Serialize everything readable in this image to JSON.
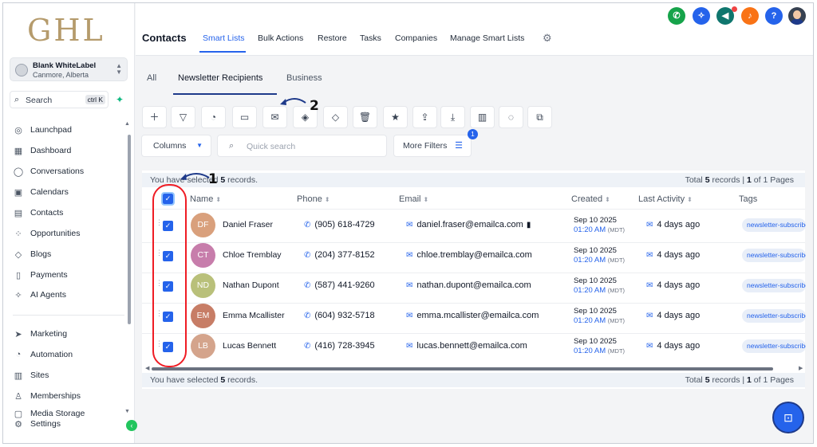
{
  "sidebar": {
    "logo": "GHL",
    "account_name": "Blank WhiteLabel",
    "account_location": "Canmore, Alberta",
    "search_label": "Search",
    "search_shortcut": "ctrl K",
    "items": [
      {
        "label": "Launchpad",
        "icon": "rocket-icon"
      },
      {
        "label": "Dashboard",
        "icon": "grid-icon"
      },
      {
        "label": "Conversations",
        "icon": "chat-bubble-icon"
      },
      {
        "label": "Calendars",
        "icon": "calendar-icon"
      },
      {
        "label": "Contacts",
        "icon": "contacts-icon"
      },
      {
        "label": "Opportunities",
        "icon": "opportunities-icon"
      },
      {
        "label": "Blogs",
        "icon": "cube-icon"
      },
      {
        "label": "Payments",
        "icon": "receipt-icon"
      },
      {
        "label": "AI Agents",
        "icon": "sparkle-icon"
      },
      {
        "label": "Marketing",
        "icon": "send-icon"
      },
      {
        "label": "Automation",
        "icon": "automation-icon"
      },
      {
        "label": "Sites",
        "icon": "sites-icon"
      },
      {
        "label": "Memberships",
        "icon": "membership-icon"
      },
      {
        "label": "Media Storage",
        "icon": "media-icon"
      },
      {
        "label": "Settings",
        "icon": "gear-icon"
      }
    ]
  },
  "topbar": {
    "title": "Contacts",
    "nav": [
      "Smart Lists",
      "Bulk Actions",
      "Restore",
      "Tasks",
      "Companies",
      "Manage Smart Lists"
    ],
    "icons": [
      {
        "name": "phone-icon",
        "color": "#16a34a"
      },
      {
        "name": "magic-icon",
        "color": "#2563eb"
      },
      {
        "name": "megaphone-icon",
        "color": "#0f766e"
      },
      {
        "name": "bell-icon",
        "color": "#f97316"
      },
      {
        "name": "help-icon",
        "color": "#2563eb"
      }
    ]
  },
  "tabs": [
    "All",
    "Newsletter Recipients",
    "Business"
  ],
  "toolbar_icons": [
    "plus-icon",
    "filter-icon",
    "automation-icon",
    "message-icon",
    "email-icon",
    "tag-icon",
    "tag-remove-icon",
    "trash-icon",
    "star-icon",
    "export-icon",
    "import-icon",
    "company-icon",
    "whatsapp-icon",
    "duplicate-icon"
  ],
  "columns_label": "Columns",
  "quick_search_placeholder": "Quick search",
  "more_filters_label": "More Filters",
  "more_filters_count": "1",
  "selection": {
    "top_prefix": "You have selected ",
    "count": "5",
    "suffix": " records.",
    "total_prefix": "Total ",
    "total_count": "5",
    "total_mid": " records | ",
    "page_current": "1",
    "page_suffix": " of 1 Pages"
  },
  "table": {
    "headers": [
      "Name",
      "Phone",
      "Email",
      "Created",
      "Last Activity",
      "Tags"
    ],
    "rows": [
      {
        "initials": "DF",
        "name": "Daniel Fraser",
        "phone": "(905) 618-4729",
        "email": "daniel.fraser@emailca.com",
        "date": "Sep 10 2025",
        "time": "01:20 AM",
        "tz": "(MDT)",
        "activity": "4 days ago",
        "tag": "newsletter-subscriber",
        "avatar_color": "#d9a07c"
      },
      {
        "initials": "CT",
        "name": "Chloe Tremblay",
        "phone": "(204) 377-8152",
        "email": "chloe.tremblay@emailca.com",
        "date": "Sep 10 2025",
        "time": "01:20 AM",
        "tz": "(MDT)",
        "activity": "4 days ago",
        "tag": "newsletter-subscriber",
        "avatar_color": "#c77dab"
      },
      {
        "initials": "ND",
        "name": "Nathan Dupont",
        "phone": "(587) 441-9260",
        "email": "nathan.dupont@emailca.com",
        "date": "Sep 10 2025",
        "time": "01:20 AM",
        "tz": "(MDT)",
        "activity": "4 days ago",
        "tag": "newsletter-subscriber",
        "avatar_color": "#b9c07a"
      },
      {
        "initials": "EM",
        "name": "Emma Mcallister",
        "phone": "(604) 932-5718",
        "email": "emma.mcallister@emailca.com",
        "date": "Sep 10 2025",
        "time": "01:20 AM",
        "tz": "(MDT)",
        "activity": "4 days ago",
        "tag": "newsletter-subscriber",
        "avatar_color": "#c77d66"
      },
      {
        "initials": "LB",
        "name": "Lucas Bennett",
        "phone": "(416) 728-3945",
        "email": "lucas.bennett@emailca.com",
        "date": "Sep 10 2025",
        "time": "01:20 AM",
        "tz": "(MDT)",
        "activity": "4 days ago",
        "tag": "newsletter-subscriber",
        "avatar_color": "#d4a48c"
      }
    ]
  },
  "annotations": {
    "marker_1": "1",
    "marker_2": "2",
    "highlight_color": "#ef1c24"
  },
  "accent_color": "#2563eb"
}
